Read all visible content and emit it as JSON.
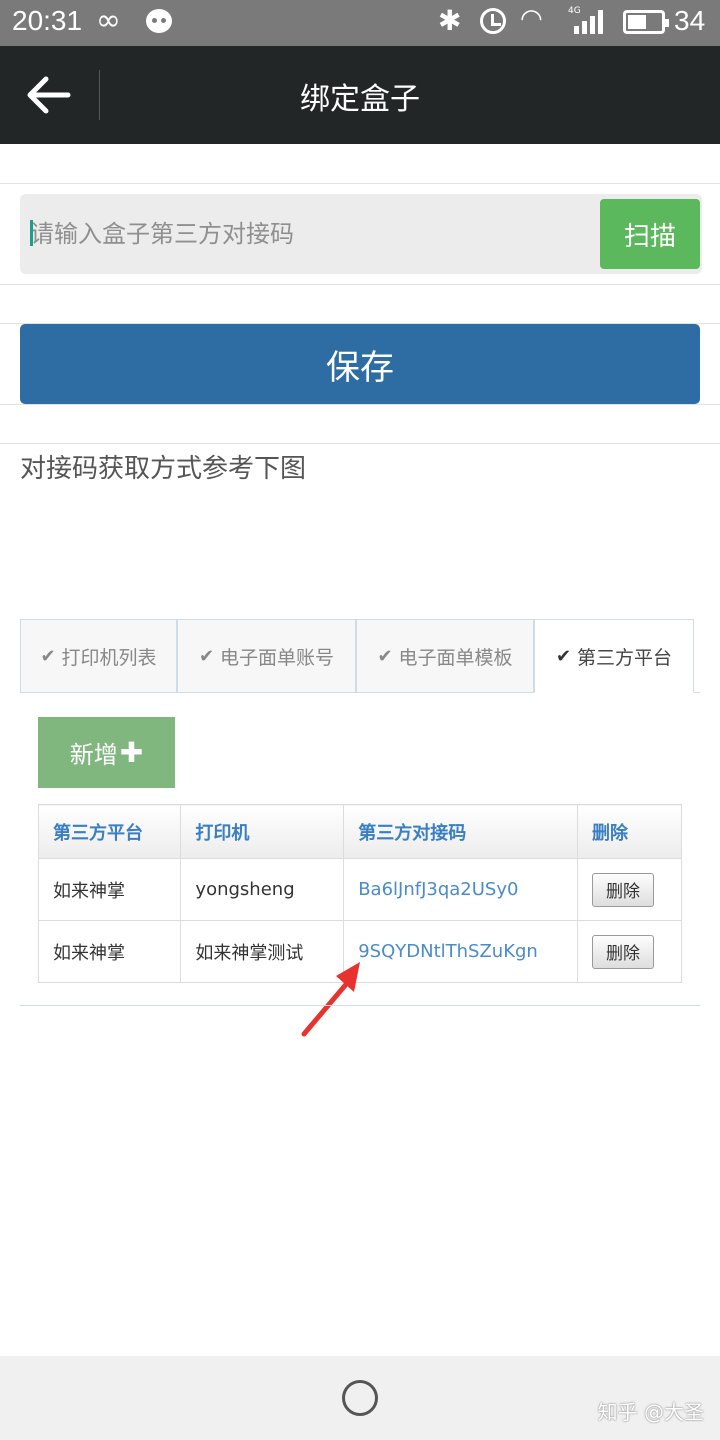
{
  "status_bar": {
    "time": "20:31",
    "battery": "34",
    "network": "4G"
  },
  "nav": {
    "title": "绑定盒子"
  },
  "form": {
    "input_placeholder": "请输入盒子第三方对接码",
    "scan_label": "扫描",
    "save_label": "保存"
  },
  "hint": "对接码获取方式参考下图",
  "reference": {
    "tabs": [
      {
        "label": "打印机列表",
        "active": false
      },
      {
        "label": "电子面单账号",
        "active": false
      },
      {
        "label": "电子面单模板",
        "active": false
      },
      {
        "label": "第三方平台",
        "active": true
      }
    ],
    "add_label": "新增",
    "table": {
      "headers": [
        "第三方平台",
        "打印机",
        "第三方对接码",
        "删除"
      ],
      "rows": [
        {
          "platform": "如来神掌",
          "printer": "yongsheng",
          "code": "Ba6lJnfJ3qa2USy0",
          "delete": "删除"
        },
        {
          "platform": "如来神掌",
          "printer": "如来神掌测试",
          "code": "9SQYDNtlThSZuKgn",
          "delete": "删除"
        }
      ]
    }
  },
  "watermark": "知乎 @大圣",
  "colors": {
    "nav_bg": "#232627",
    "save": "#2e6da4",
    "scan": "#5cb85c",
    "add": "#7fb77e",
    "arrow": "#e8322d"
  }
}
